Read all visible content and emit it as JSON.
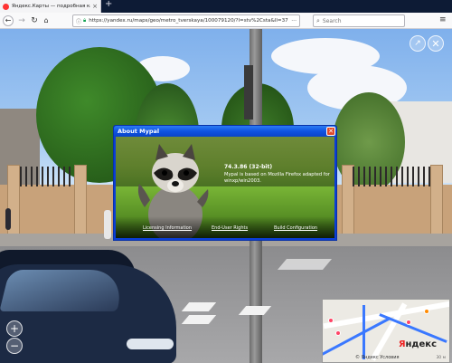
{
  "browser": {
    "tab_title": "Яндекс.Карты — подробная карт",
    "new_tab_symbol": "+",
    "url": "https://yandex.ru/maps/geo/metro_tverskaya/100079120/?l=stv%2Csta&ll=37",
    "search_placeholder": "Search",
    "colors": {
      "tab_strip": "#0d1b35",
      "toolbar": "#f9f9fa"
    }
  },
  "map_controls": {
    "expand_icon": "↗",
    "close_icon": "✕",
    "zoom_in": "+",
    "zoom_out": "−"
  },
  "minimap": {
    "logo_red": "Я",
    "logo_black": "ндекс",
    "footer": "© Яндекс Условия",
    "scale": "30 м"
  },
  "about_dialog": {
    "title": "About Mypal",
    "version": "74.3.86 (32-bit)",
    "description": "Mypal is based on Mozilla Firefox adapted for winxp/win2003.",
    "links": {
      "licensing": "Licensing Information",
      "end_user": "End-User Rights",
      "build": "Build Configuration"
    },
    "colors": {
      "title_bar": "#0f53e1",
      "close_button": "#e04a2a"
    }
  }
}
